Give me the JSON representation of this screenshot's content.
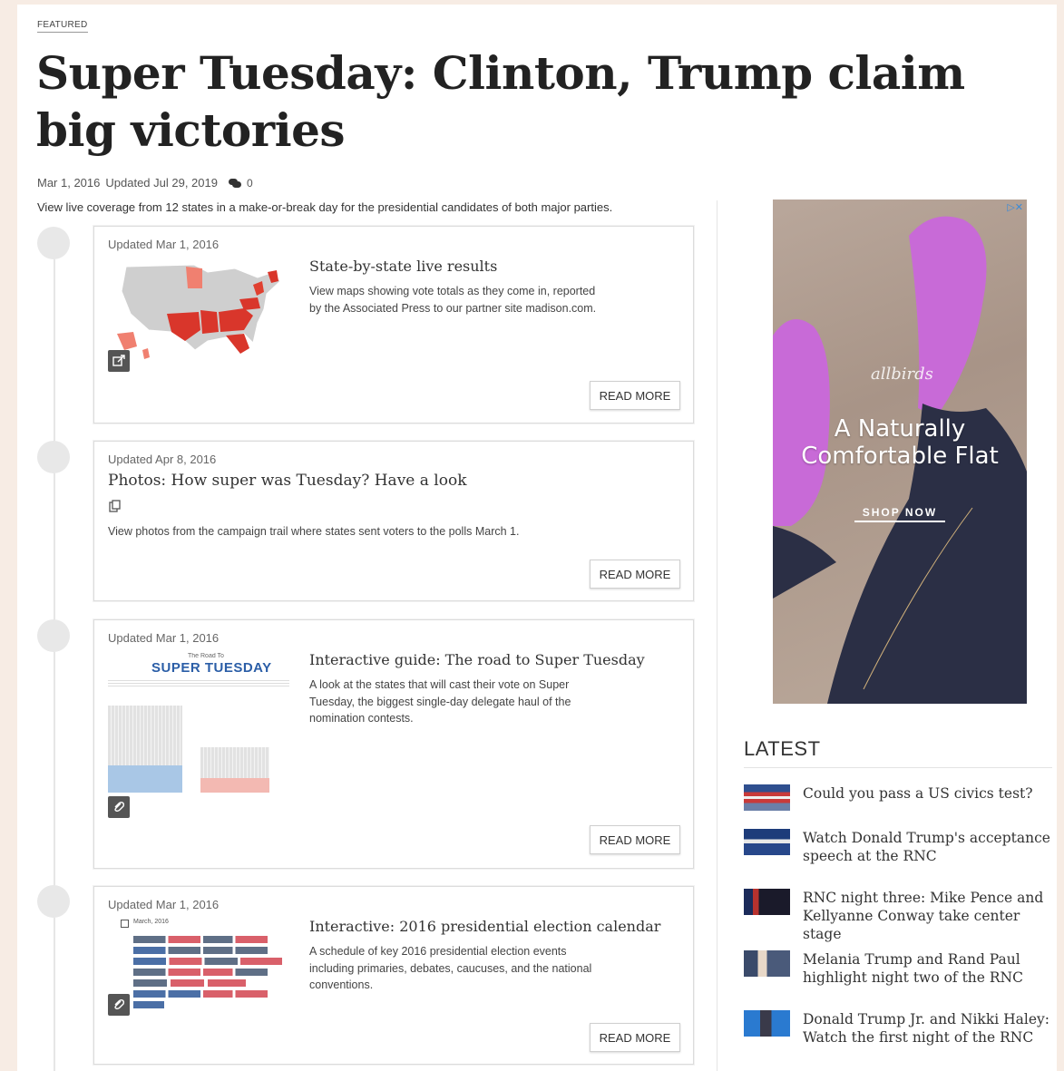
{
  "featured_label": "FEATURED",
  "headline": "Super Tuesday: Clinton, Trump claim big victories",
  "byline": {
    "published": "Mar 1, 2016",
    "updated": "Updated Jul 29, 2019",
    "comment_count": "0"
  },
  "summary": "View live coverage from 12 states in a make-or-break day for the presidential candidates of both major parties.",
  "cards": [
    {
      "updated": "Updated Mar 1, 2016",
      "title": "State-by-state live results",
      "description": "View maps showing vote totals as they come in, reported by the Associated Press to our partner site madison.com.",
      "read_more": "READ MORE",
      "badge_icon": "external-link-icon"
    },
    {
      "updated": "Updated Apr 8, 2016",
      "title": "Photos: How super was Tuesday? Have a look",
      "description": "View photos from the campaign trail where states sent voters to the polls March 1.",
      "read_more": "READ MORE",
      "badge_icon": "copy-icon"
    },
    {
      "updated": "Updated Mar 1, 2016",
      "title": "Interactive guide: The road to Super Tuesday",
      "description": "A look at the states that will cast their vote on Super Tuesday, the biggest single-day delegate haul of the nomination contests.",
      "read_more": "READ MORE",
      "badge_icon": "paperclip-icon",
      "thumb_caption_small": "The Road To",
      "thumb_caption_big": "SUPER TUESDAY"
    },
    {
      "updated": "Updated Mar 1, 2016",
      "title": "Interactive: 2016 presidential election calendar",
      "description": "A schedule of key 2016 presidential election events including primaries, debates, caucuses, and the national conventions.",
      "read_more": "READ MORE",
      "badge_icon": "paperclip-icon",
      "thumb_caption": "March, 2016"
    }
  ],
  "ad": {
    "brand": "allbirds",
    "line1": "A Naturally",
    "line2": "Comfortable Flat",
    "cta": "SHOP NOW",
    "close": "▷✕"
  },
  "latest": {
    "heading": "LATEST",
    "items": [
      {
        "title": "Could you pass a US civics test?"
      },
      {
        "title": "Watch Donald Trump's acceptance speech at the RNC"
      },
      {
        "title": "RNC night three: Mike Pence and Kellyanne Conway take center stage"
      },
      {
        "title": "Melania Trump and Rand Paul highlight night two of the RNC"
      },
      {
        "title": "Donald Trump Jr. and Nikki Haley: Watch the first night of the RNC"
      }
    ]
  },
  "colors": {
    "accent_red": "#d9362b",
    "map_gray": "#cfcfcf",
    "ad_pink": "#c96ad6",
    "ad_pants": "#2b2f45"
  }
}
